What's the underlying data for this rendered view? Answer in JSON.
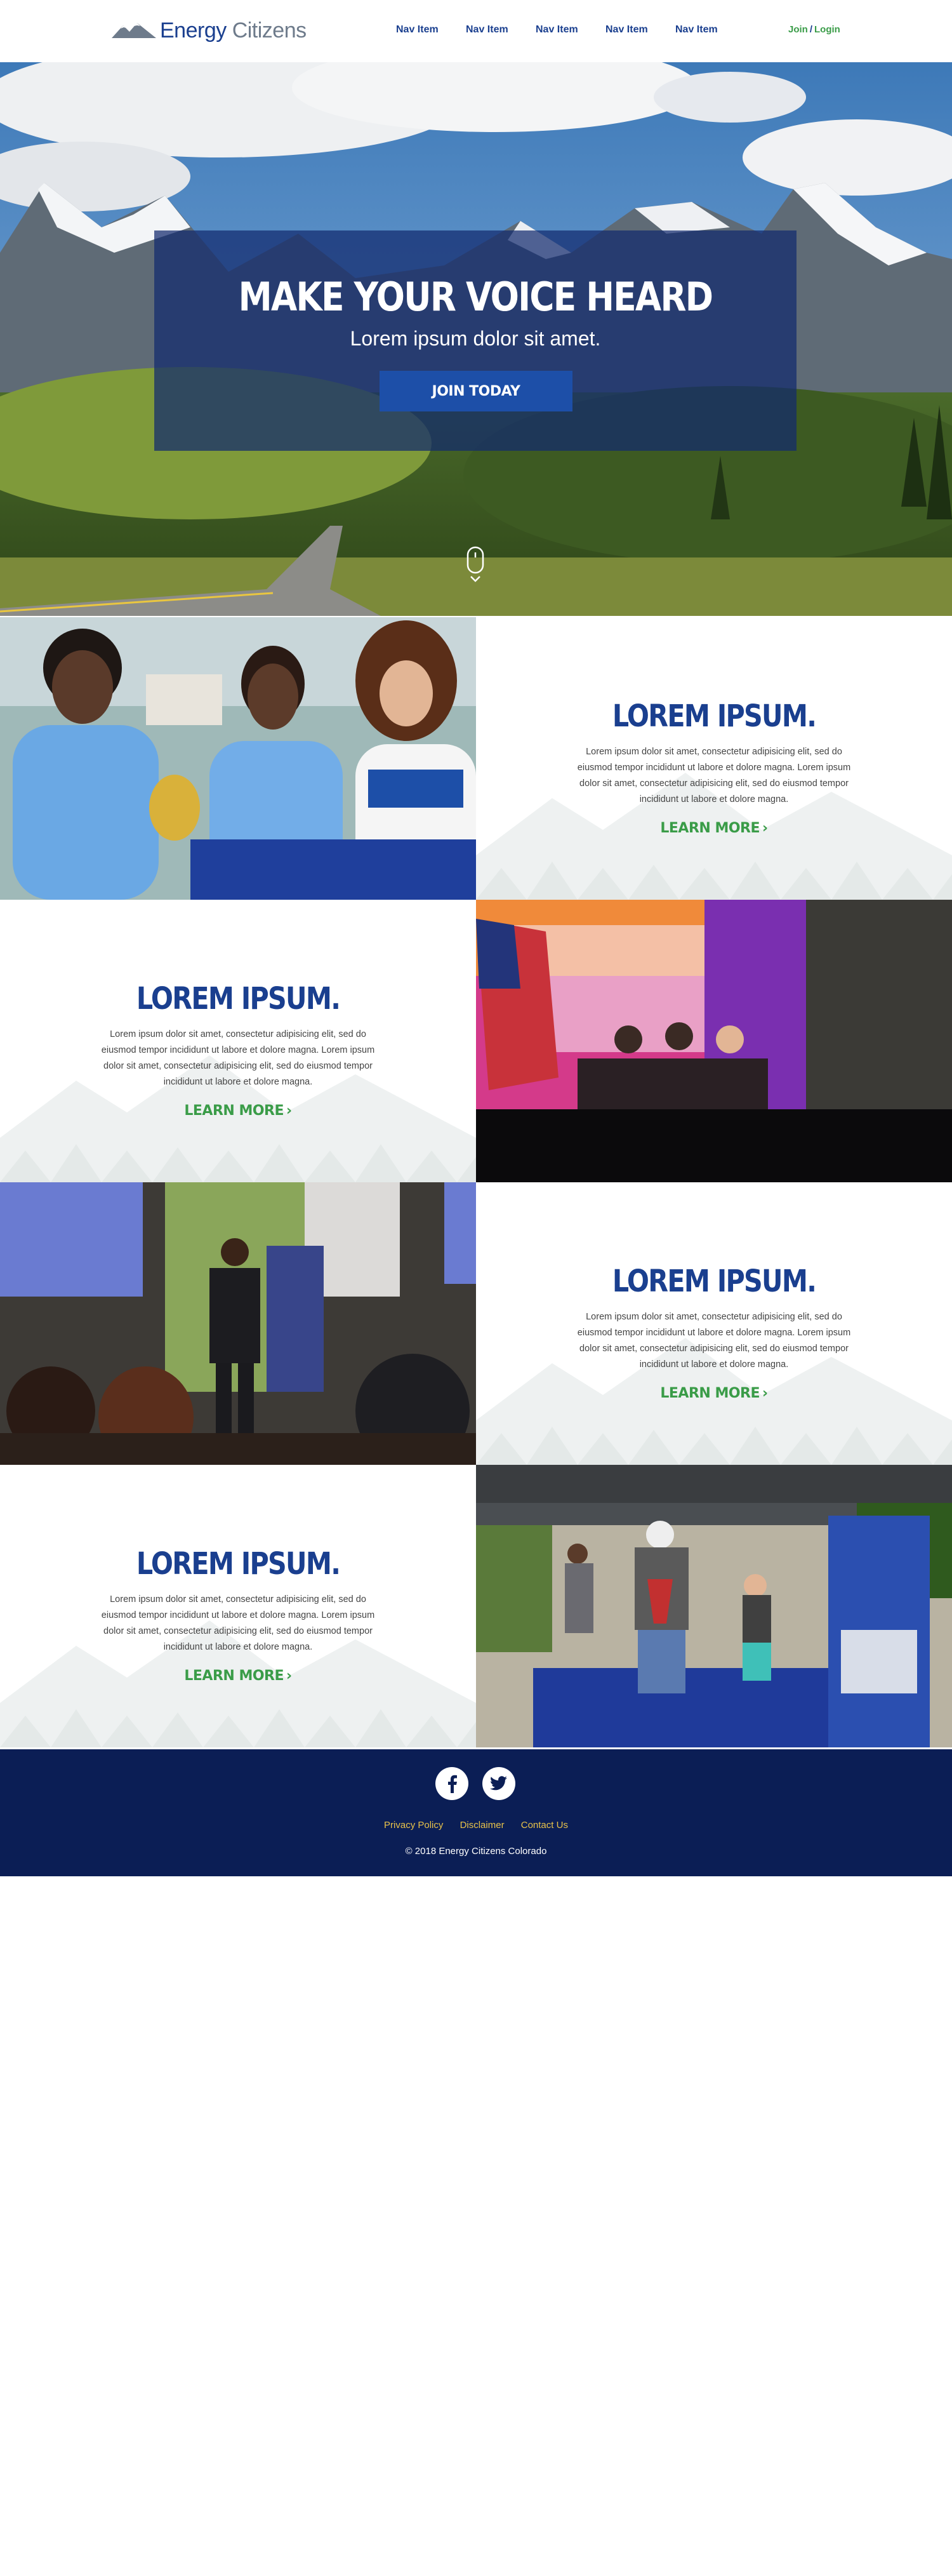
{
  "brand": {
    "name_part1": "Energy",
    "name_part2": "Citizens",
    "primary_color": "#1a3f8f",
    "accent_color": "#3a9c48",
    "footer_color": "#0b1e55"
  },
  "nav": {
    "items": [
      "Nav Item",
      "Nav Item",
      "Nav Item",
      "Nav Item",
      "Nav Item"
    ],
    "join_label": "Join",
    "separator": "/",
    "login_label": "Login"
  },
  "hero": {
    "title": "MAKE YOUR VOICE HEARD",
    "subtitle": "Lorem ipsum dolor sit amet.",
    "cta_label": "JOIN TODAY"
  },
  "sections": [
    {
      "title": "LOREM IPSUM.",
      "body": "Lorem ipsum dolor sit amet, consectetur adipisicing elit, sed do eiusmod tempor incididunt ut labore et dolore magna. Lorem ipsum dolor sit amet, consectetur adipisicing elit, sed do eiusmod tempor incididunt ut labore et dolore magna.",
      "link_label": "LEARN MORE",
      "photo_icon": "photo-volunteers-with-shirts"
    },
    {
      "title": "LOREM IPSUM.",
      "body": "Lorem ipsum dolor sit amet, consectetur adipisicing elit, sed do eiusmod tempor incididunt ut labore et dolore magna. Lorem ipsum dolor sit amet, consectetur adipisicing elit, sed do eiusmod tempor incididunt ut labore et dolore magna.",
      "link_label": "LEARN MORE",
      "photo_icon": "photo-stage-panel"
    },
    {
      "title": "LOREM IPSUM.",
      "body": "Lorem ipsum dolor sit amet, consectetur adipisicing elit, sed do eiusmod tempor incididunt ut labore et dolore magna. Lorem ipsum dolor sit amet, consectetur adipisicing elit, sed do eiusmod tempor incididunt ut labore et dolore magna.",
      "link_label": "LEARN MORE",
      "photo_icon": "photo-reception-speaker"
    },
    {
      "title": "LOREM IPSUM.",
      "body": "Lorem ipsum dolor sit amet, consectetur adipisicing elit, sed do eiusmod tempor incididunt ut labore et dolore magna. Lorem ipsum dolor sit amet, consectetur adipisicing elit, sed do eiusmod tempor incididunt ut labore et dolore magna.",
      "link_label": "LEARN MORE",
      "photo_icon": "photo-outdoor-booth"
    }
  ],
  "footer": {
    "social": [
      "facebook-icon",
      "twitter-icon"
    ],
    "links": [
      "Privacy Policy",
      "Disclaimer",
      "Contact Us"
    ],
    "copyright": "© 2018 Energy Citizens Colorado"
  }
}
